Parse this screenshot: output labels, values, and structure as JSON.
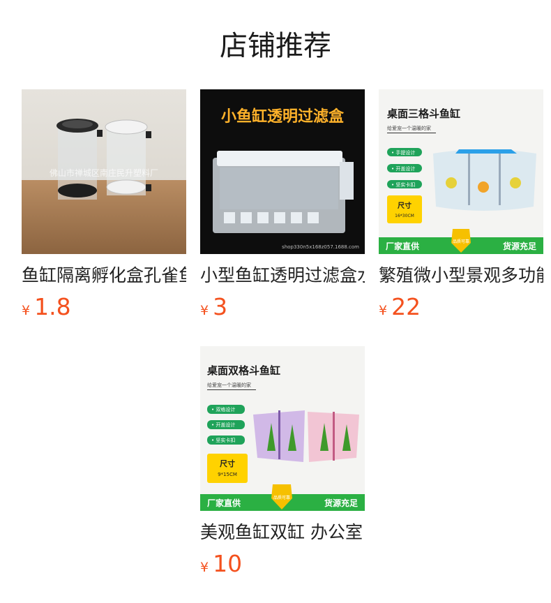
{
  "section": {
    "title": "店铺推荐"
  },
  "products": [
    {
      "name": "鱼缸隔离孵化盒孔雀鱼",
      "currency": "¥",
      "price": "1.8",
      "image_watermark": "佛山市禅城区南庄民升塑料厂"
    },
    {
      "name": "小型鱼缸透明过滤盒水",
      "currency": "¥",
      "price": "3",
      "image_banner": "小鱼缸透明过滤盒",
      "image_caption": "shop330n5x168z057.1688.com"
    },
    {
      "name": "繁殖微小型景观多功能",
      "currency": "¥",
      "price": "22",
      "image_title": "桌面三格斗鱼缸",
      "image_subtitle": "给爱宠一个温暖的家",
      "image_tags": [
        "• 手提设计",
        "• 开盖设计",
        "• 坚实卡扣"
      ],
      "image_size_label": "尺寸",
      "image_size_value": "16*30CM",
      "image_footer_left": "厂家直供",
      "image_badge": "品质可靠",
      "image_footer_right": "货源充足"
    },
    {
      "name": "美观鱼缸双缸 办公室",
      "currency": "¥",
      "price": "10",
      "image_title": "桌面双格斗鱼缸",
      "image_subtitle": "给爱宠一个温暖的家",
      "image_tags": [
        "• 双格设计",
        "• 开盖设计",
        "• 坚实卡扣"
      ],
      "image_size_label": "尺寸",
      "image_size_value": "9*15CM",
      "image_footer_left": "厂家直供",
      "image_badge": "品质可靠",
      "image_footer_right": "货源充足"
    }
  ],
  "colors": {
    "price": "#f4511e",
    "tag_green": "#1fa35a",
    "footer_green": "#2bb043",
    "size_yellow": "#ffd200"
  }
}
